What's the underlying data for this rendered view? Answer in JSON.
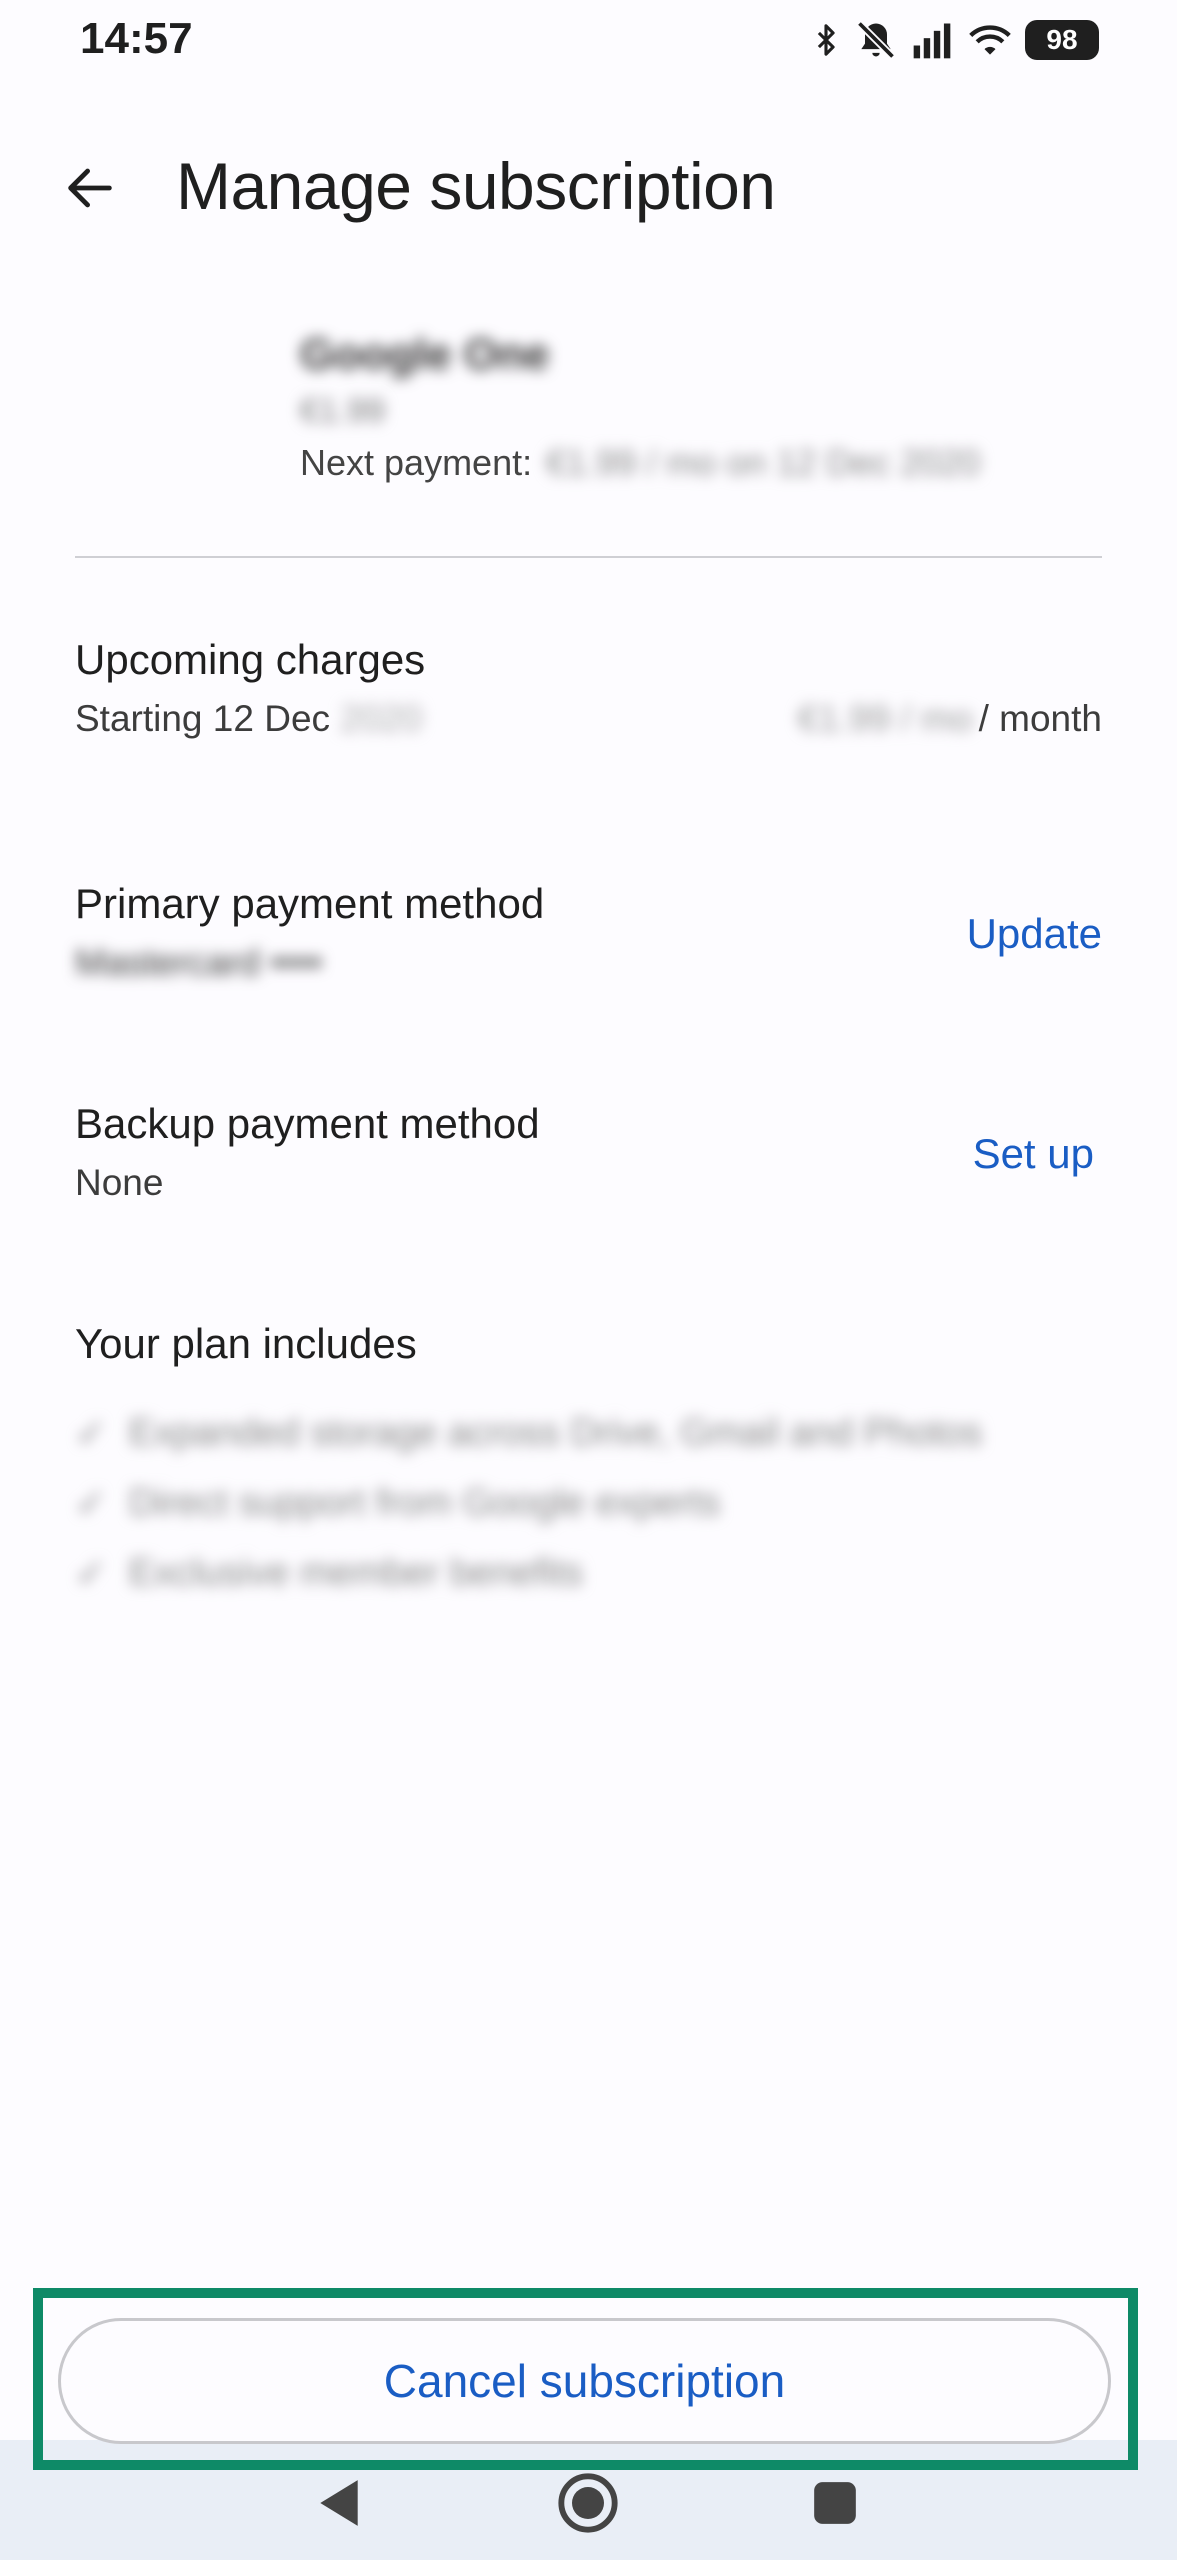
{
  "status_bar": {
    "time": "14:57",
    "battery": "98",
    "icons": [
      "bluetooth-icon",
      "muted-bell-icon",
      "signal-icon",
      "wifi-icon",
      "battery-icon"
    ]
  },
  "app_bar": {
    "title": "Manage subscription",
    "back_icon": "arrow-left-icon"
  },
  "product": {
    "name": "Google One",
    "price": "€1.99",
    "next_payment_label": "Next payment:",
    "next_payment_value": "€1.99 / mo on 12 Dec 2020"
  },
  "upcoming_charges": {
    "title": "Upcoming charges",
    "starting_label": "Starting 12 Dec",
    "starting_year": "2020",
    "amount": "€1.99 / mo",
    "per": "/ month"
  },
  "primary_payment": {
    "title": "Primary payment method",
    "value": "Mastercard ••••",
    "action": "Update"
  },
  "backup_payment": {
    "title": "Backup payment method",
    "value": "None",
    "action": "Set up"
  },
  "plan": {
    "title": "Your plan includes",
    "items": [
      "Expanded storage across Drive, Gmail and Photos",
      "Direct support from Google experts",
      "Exclusive member benefits"
    ]
  },
  "cancel": {
    "label": "Cancel subscription"
  },
  "colors": {
    "accent": "#1a5dc4",
    "highlight": "#0e8a67",
    "nav_bar": "#e9eef6"
  },
  "nav": {
    "icons": [
      "back-triangle-icon",
      "home-circle-icon",
      "recents-square-icon"
    ]
  }
}
